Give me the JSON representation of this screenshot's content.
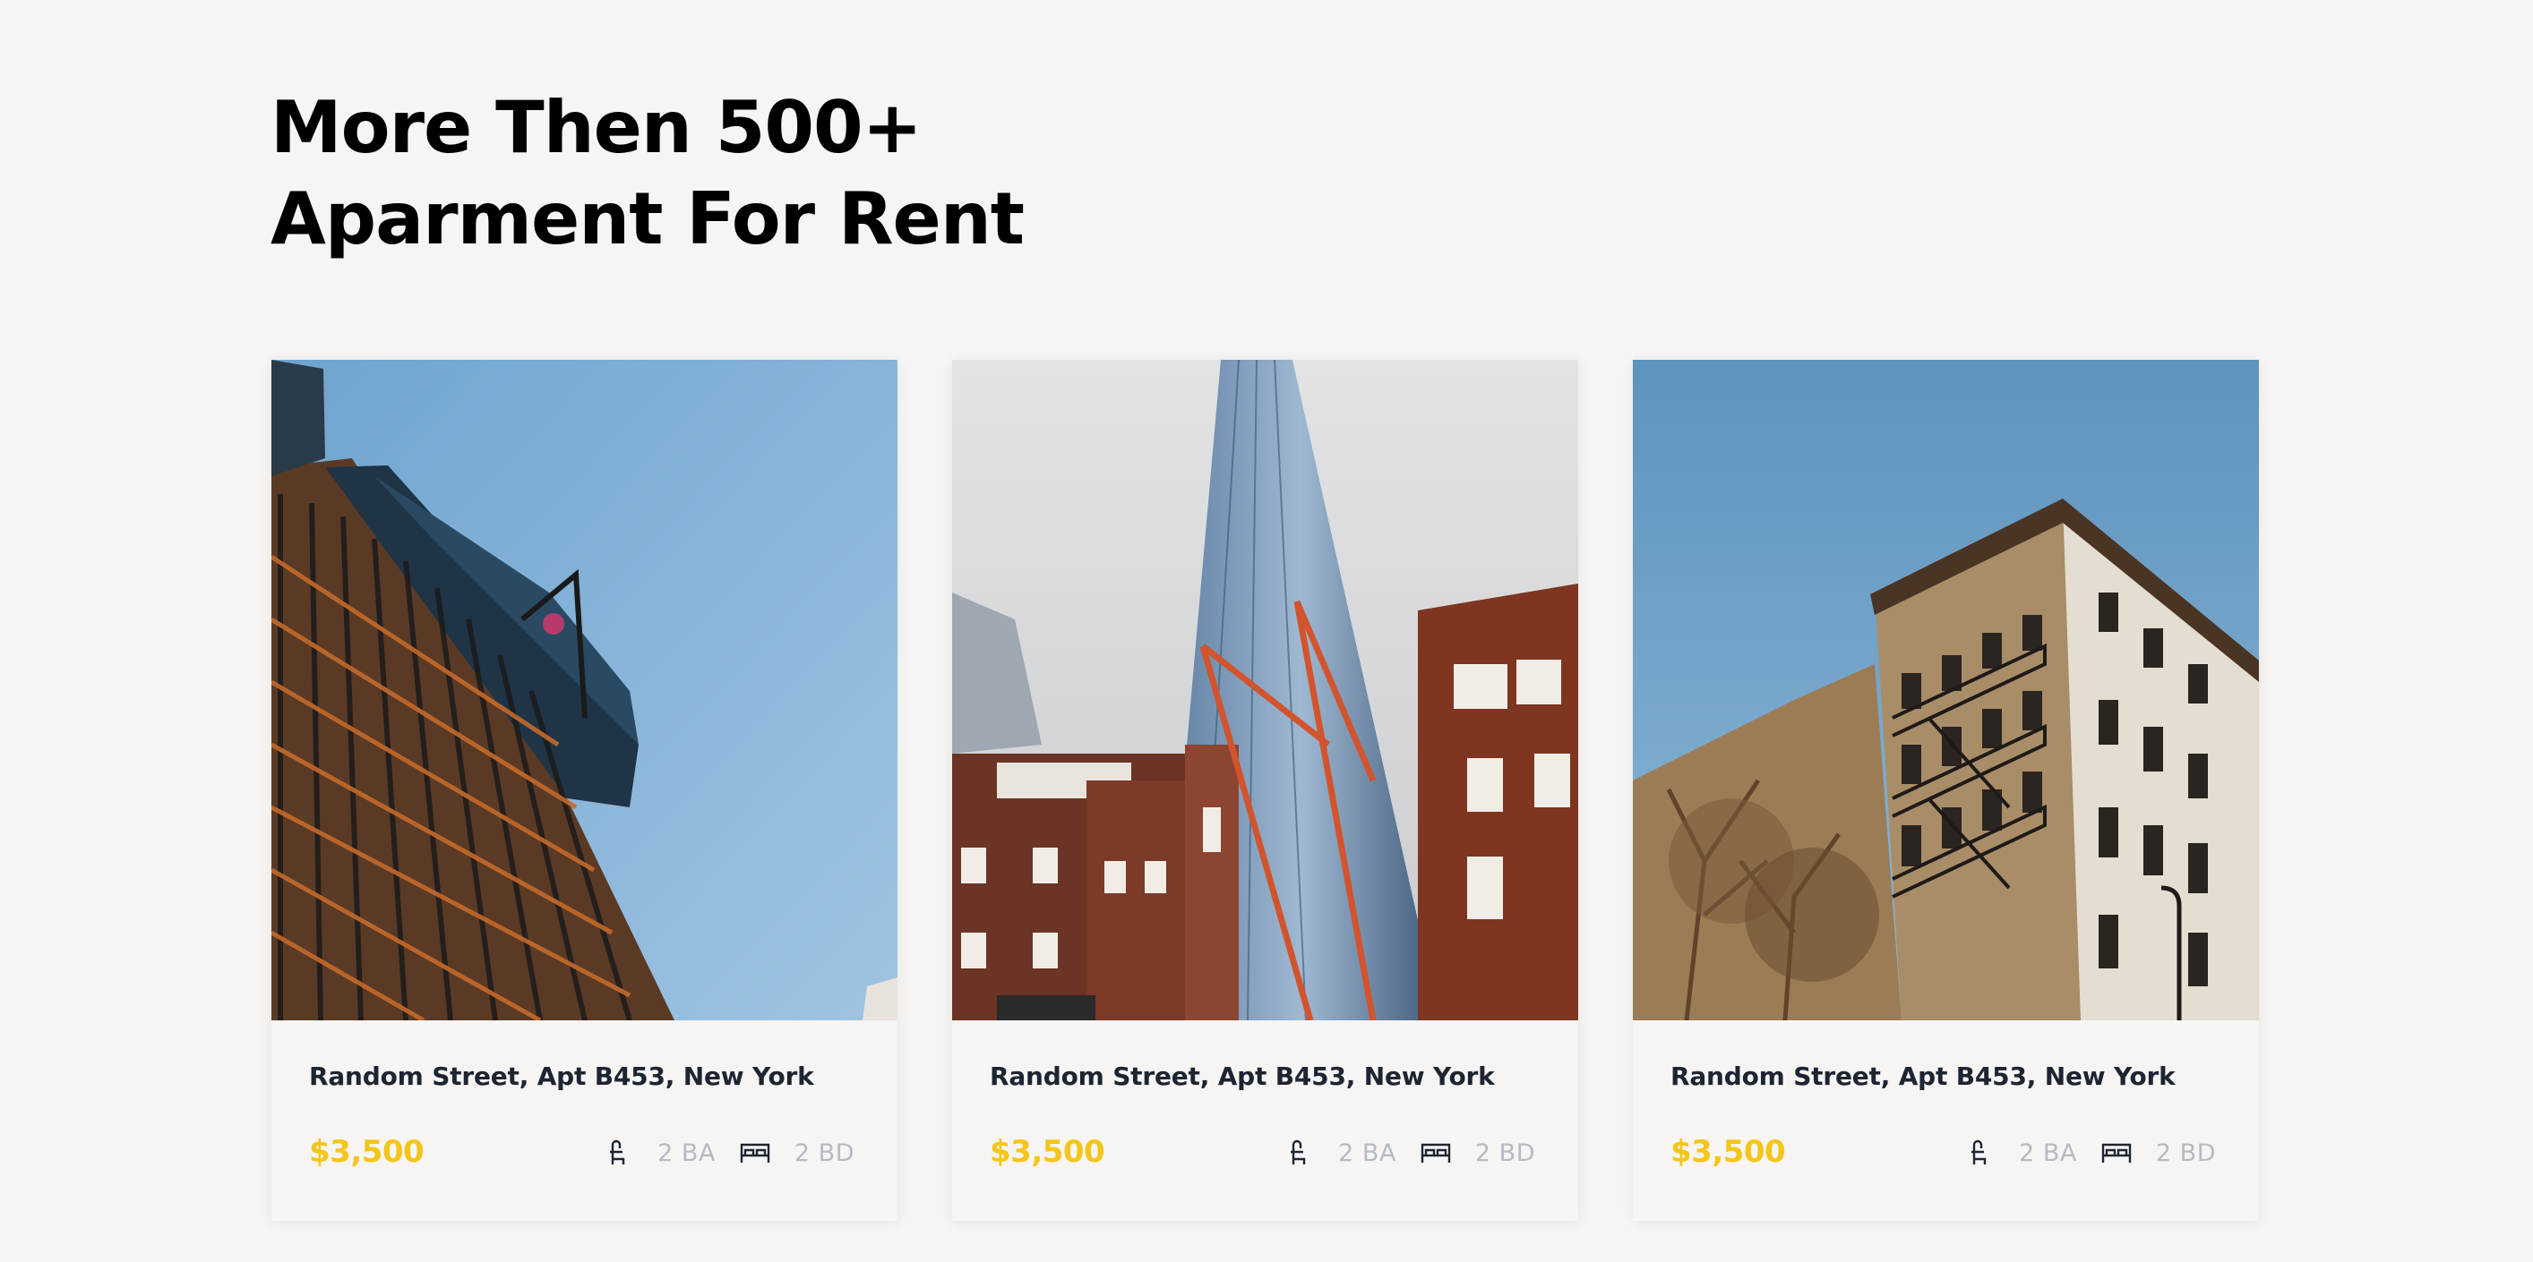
{
  "section": {
    "title_line1": "More Then 500+",
    "title_line2": "Aparment For Rent"
  },
  "listings": [
    {
      "address": "Random Street, Apt B453, New York",
      "price": "$3,500",
      "baths": "2 BA",
      "beds": "2 BD",
      "bath_icon": "bathtub-icon",
      "bed_icon": "bed-icon"
    },
    {
      "address": "Random Street, Apt B453, New York",
      "price": "$3,500",
      "baths": "2 BA",
      "beds": "2 BD",
      "bath_icon": "bathtub-icon",
      "bed_icon": "bed-icon"
    },
    {
      "address": "Random Street, Apt B453, New York",
      "price": "$3,500",
      "baths": "2 BA",
      "beds": "2 BD",
      "bath_icon": "bathtub-icon",
      "bed_icon": "bed-icon"
    }
  ],
  "colors": {
    "background": "#f6f5f3",
    "price": "#f5c518",
    "address": "#1d2432",
    "meta": "#b5bac3"
  }
}
